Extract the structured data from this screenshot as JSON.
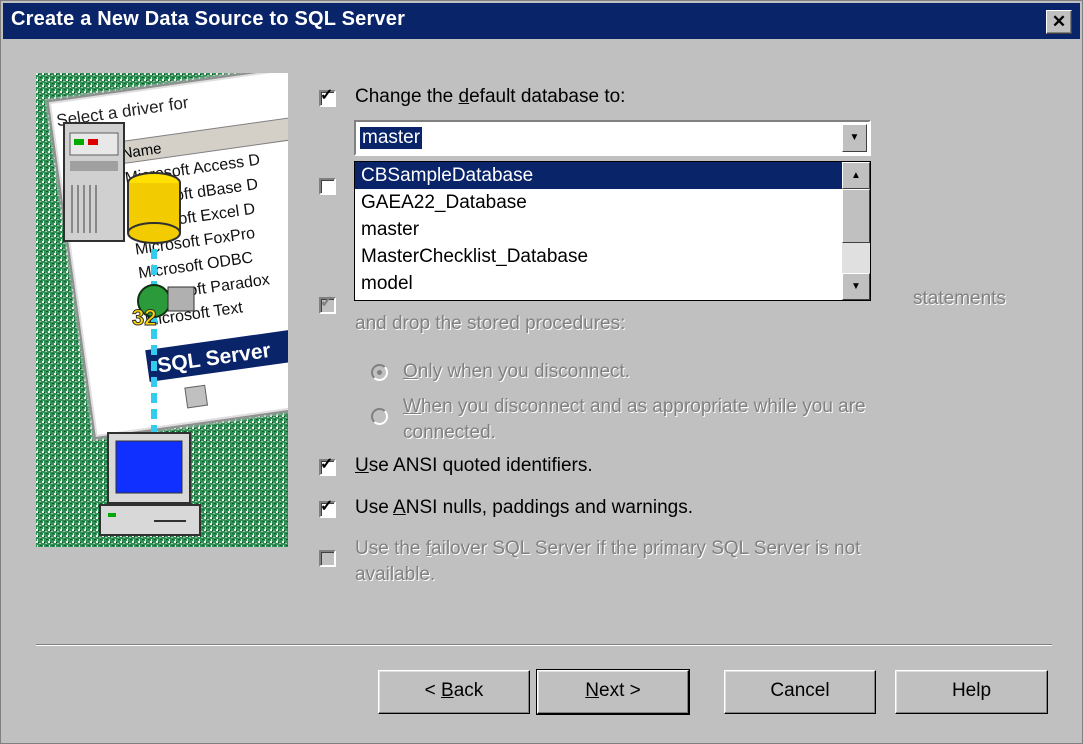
{
  "window": {
    "title": "Create a New Data Source to SQL Server",
    "close_glyph": "✕"
  },
  "illustration": {
    "heading": "Select a driver for",
    "column": "Name",
    "drivers": [
      "Microsoft Access D",
      "Microsoft dBase D",
      "Microsoft Excel D",
      "Microsoft FoxPro",
      "Microsoft ODBC",
      "Microsoft Paradox",
      "Microsoft Text"
    ],
    "selected": "SQL Server",
    "badge": "32"
  },
  "options": {
    "change_db": {
      "label_pre": "Change the ",
      "label_u": "d",
      "label_post": "efault database to:",
      "checked": true
    },
    "combo": {
      "value": "master"
    },
    "dropdown_items": [
      "CBSampleDatabase",
      "GAEA22_Database",
      "master",
      "MasterChecklist_Database",
      "model"
    ],
    "create_proc_tail": "statements",
    "create_proc_line2": "and drop the stored procedures:",
    "radio1": {
      "u": "O",
      "rest": "nly when you disconnect."
    },
    "radio2": {
      "u": "W",
      "rest": "hen you disconnect and as appropriate while you are",
      "line2": "connected."
    },
    "ansi_quoted": {
      "u": "U",
      "rest": "se ANSI quoted identifiers."
    },
    "ansi_nulls": {
      "pre": "Use ",
      "u": "A",
      "rest": "NSI nulls, paddings and warnings."
    },
    "failover": {
      "pre": "Use the ",
      "u": "f",
      "rest": "ailover SQL Server if the primary SQL Server is not",
      "line2": "available."
    }
  },
  "buttons": {
    "back": {
      "pre": "< ",
      "u": "B",
      "rest": "ack"
    },
    "next": {
      "u": "N",
      "rest": "ext >"
    },
    "cancel": "Cancel",
    "help": "Help"
  },
  "colors": {
    "titlebar": "#0a246a",
    "face": "#c0c0c0",
    "selection": "#0a246a"
  }
}
